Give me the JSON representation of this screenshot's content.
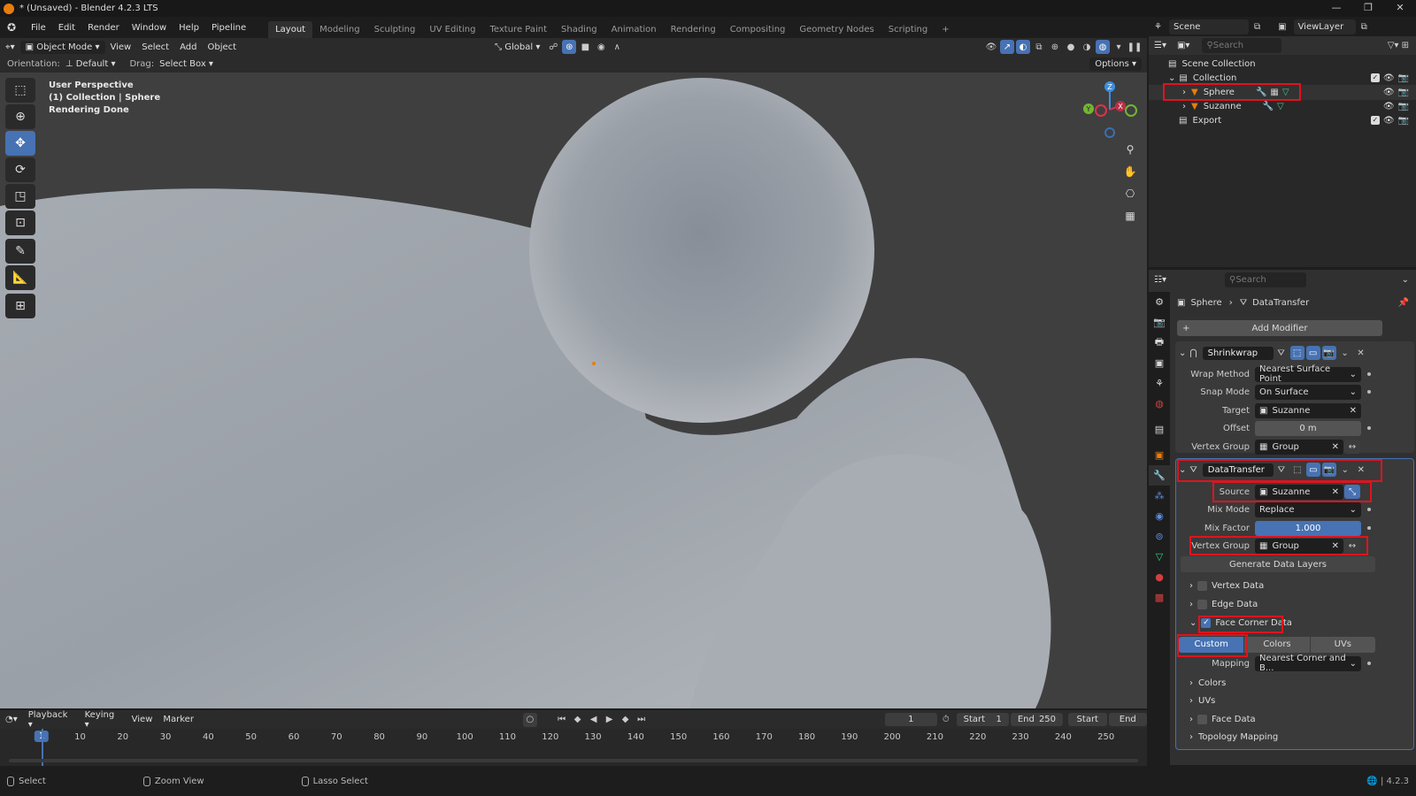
{
  "window": {
    "title": "* (Unsaved) - Blender 4.2.3 LTS",
    "controls": [
      "—",
      "❐",
      "✕"
    ]
  },
  "menu": {
    "items": [
      "File",
      "Edit",
      "Render",
      "Window",
      "Help",
      "Pipeline"
    ]
  },
  "workspaces": {
    "tabs": [
      "Layout",
      "Modeling",
      "Sculpting",
      "UV Editing",
      "Texture Paint",
      "Shading",
      "Animation",
      "Rendering",
      "Compositing",
      "Geometry Nodes",
      "Scripting"
    ],
    "active": "Layout",
    "add": "+"
  },
  "topright": {
    "scene": "Scene",
    "viewlayer": "ViewLayer"
  },
  "viewport_header": {
    "mode": "Object Mode",
    "menus": [
      "View",
      "Select",
      "Add",
      "Object"
    ],
    "transform_orientation": "Global",
    "options": "Options"
  },
  "tool_settings": {
    "orientation_label": "Orientation:",
    "orientation_value": "Default",
    "drag_label": "Drag:",
    "drag_value": "Select Box"
  },
  "viewport": {
    "info_lines": [
      "User Perspective",
      "(1) Collection | Sphere",
      "Rendering Done"
    ],
    "gizmo": {
      "x": "X",
      "y": "Y",
      "z": "Z"
    }
  },
  "outliner": {
    "search_placeholder": "Search",
    "rows": [
      {
        "name": "Scene Collection"
      },
      {
        "name": "Collection"
      },
      {
        "name": "Sphere"
      },
      {
        "name": "Suzanne"
      },
      {
        "name": "Export"
      }
    ]
  },
  "properties": {
    "search_placeholder": "Search",
    "breadcrumb": {
      "object": "Sphere",
      "modifier": "DataTransfer"
    },
    "add_modifier": "Add Modifier",
    "shrinkwrap": {
      "name": "Shrinkwrap",
      "fields": [
        {
          "label": "Wrap Method",
          "value": "Nearest Surface Point"
        },
        {
          "label": "Snap Mode",
          "value": "On Surface"
        },
        {
          "label": "Target",
          "value": "Suzanne"
        },
        {
          "label": "Offset",
          "value": "0 m"
        },
        {
          "label": "Vertex Group",
          "value": "Group"
        }
      ]
    },
    "datatransfer": {
      "name": "DataTransfer",
      "fields": [
        {
          "label": "Source",
          "value": "Suzanne"
        },
        {
          "label": "Mix Mode",
          "value": "Replace"
        },
        {
          "label": "Mix Factor",
          "value": "1.000"
        },
        {
          "label": "Vertex Group",
          "value": "Group"
        }
      ],
      "generate": "Generate Data Layers",
      "sections": [
        "Vertex Data",
        "Edge Data",
        "Face Corner Data"
      ],
      "face_corner_tabs": [
        "Custom Norm...",
        "Colors",
        "UVs"
      ],
      "mapping_label": "Mapping",
      "mapping_value": "Nearest Corner and B...",
      "subsections": [
        "Colors",
        "UVs",
        "Face Data",
        "Topology Mapping"
      ]
    }
  },
  "timeline": {
    "menus": [
      "Playback",
      "Keying",
      "View",
      "Marker"
    ],
    "current_frame": "1",
    "start_label": "Start",
    "start": "1",
    "end_label": "End",
    "end": "250",
    "btn_start": "Start",
    "btn_end": "End",
    "ticks": [
      "1",
      "10",
      "20",
      "30",
      "40",
      "50",
      "60",
      "70",
      "80",
      "90",
      "100",
      "110",
      "120",
      "130",
      "140",
      "150",
      "160",
      "170",
      "180",
      "190",
      "200",
      "210",
      "220",
      "230",
      "240",
      "250"
    ]
  },
  "statusbar": {
    "items": [
      "Select",
      "Zoom View",
      "Lasso Select"
    ],
    "version": "4.2.3"
  },
  "colors": {
    "accent": "#4772b3",
    "highlight": "#e0131e",
    "object_orange": "#e87d0d"
  }
}
